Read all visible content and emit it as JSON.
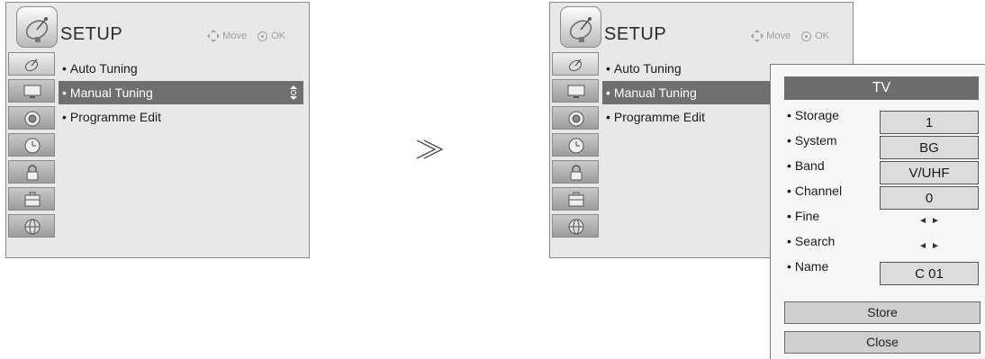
{
  "left_menu": {
    "title": "SETUP",
    "hint_move": "Move",
    "hint_ok": "OK",
    "items": [
      {
        "label": "Auto Tuning",
        "selected": false
      },
      {
        "label": "Manual Tuning",
        "selected": true
      },
      {
        "label": "Programme Edit",
        "selected": false
      }
    ],
    "sidebar_icons": [
      "setup-satellite-icon",
      "picture-tv-icon",
      "audio-speaker-icon",
      "time-clock-icon",
      "lock-icon",
      "option-briefcase-icon",
      "network-globe-icon"
    ]
  },
  "right_menu": {
    "title": "SETUP",
    "hint_move": "Move",
    "hint_ok": "OK",
    "items": [
      {
        "label": "Auto Tuning",
        "selected": false
      },
      {
        "label": "Manual Tuning",
        "selected": true
      },
      {
        "label": "Programme Edit",
        "selected": false
      }
    ]
  },
  "transition_symbol": "≫",
  "popup": {
    "title": "TV",
    "fields": {
      "storage": {
        "label": "Storage",
        "value": "1"
      },
      "system": {
        "label": "System",
        "value": "BG"
      },
      "band": {
        "label": "Band",
        "value": "V/UHF"
      },
      "channel": {
        "label": "Channel",
        "value": "0"
      },
      "fine": {
        "label": "Fine",
        "left": "◄",
        "right": "►"
      },
      "search": {
        "label": "Search",
        "left": "◄",
        "right": "►"
      },
      "name": {
        "label": "Name",
        "value": "C 01"
      }
    },
    "store_label": "Store",
    "close_label": "Close"
  },
  "bullet": "•",
  "colors": {
    "menu_bg": "#e8e8e8",
    "selected_bg": "#6f6f6f",
    "popup_title_bg": "#6d6d6d",
    "field_bg": "#dcdcdc"
  }
}
